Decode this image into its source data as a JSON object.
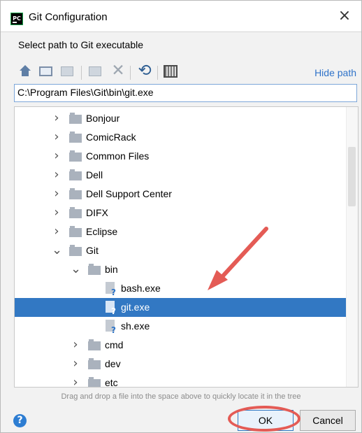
{
  "window": {
    "title": "Git Configuration",
    "subtitle": "Select path to Git executable"
  },
  "toolbar": {
    "hide_path": "Hide path",
    "icons": [
      "home-icon",
      "desktop-icon",
      "project-icon",
      "new-folder-icon",
      "delete-icon",
      "refresh-icon",
      "show-hidden-icon"
    ]
  },
  "path": {
    "value": "C:\\Program Files\\Git\\bin\\git.exe"
  },
  "tree": {
    "items": [
      {
        "label": "Bonjour",
        "level": 1,
        "type": "folder",
        "expanded": false
      },
      {
        "label": "ComicRack",
        "level": 1,
        "type": "folder",
        "expanded": false
      },
      {
        "label": "Common Files",
        "level": 1,
        "type": "folder",
        "expanded": false
      },
      {
        "label": "Dell",
        "level": 1,
        "type": "folder",
        "expanded": false
      },
      {
        "label": "Dell Support Center",
        "level": 1,
        "type": "folder",
        "expanded": false
      },
      {
        "label": "DIFX",
        "level": 1,
        "type": "folder",
        "expanded": false
      },
      {
        "label": "Eclipse",
        "level": 1,
        "type": "folder",
        "expanded": false
      },
      {
        "label": "Git",
        "level": 1,
        "type": "folder",
        "expanded": true
      },
      {
        "label": "bin",
        "level": 2,
        "type": "folder",
        "expanded": true
      },
      {
        "label": "bash.exe",
        "level": 3,
        "type": "file"
      },
      {
        "label": "git.exe",
        "level": 3,
        "type": "file",
        "selected": true
      },
      {
        "label": "sh.exe",
        "level": 3,
        "type": "file"
      },
      {
        "label": "cmd",
        "level": 2,
        "type": "folder",
        "expanded": false
      },
      {
        "label": "dev",
        "level": 2,
        "type": "folder",
        "expanded": false
      },
      {
        "label": "etc",
        "level": 2,
        "type": "folder",
        "expanded": false
      }
    ]
  },
  "hint": "Drag and drop a file into the space above to quickly locate it in the tree",
  "buttons": {
    "ok": "OK",
    "cancel": "Cancel",
    "help": "?"
  },
  "colors": {
    "selection": "#3278c3",
    "annotation": "#e45b55",
    "link": "#2f73c9"
  }
}
